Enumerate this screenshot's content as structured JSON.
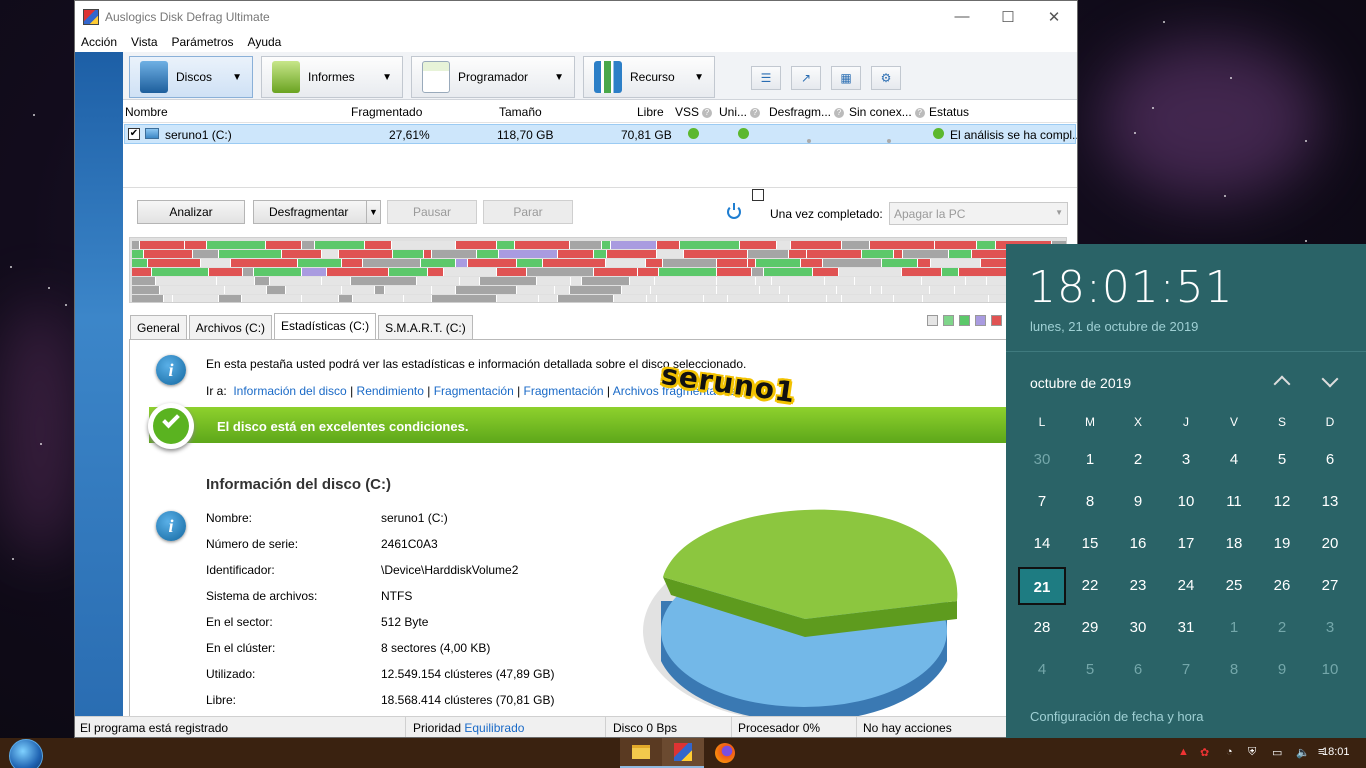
{
  "window": {
    "title": "Auslogics Disk Defrag Ultimate",
    "minimize": "—",
    "maximize": "☐",
    "close": "✕"
  },
  "menu": [
    "Acción",
    "Vista",
    "Parámetros",
    "Ayuda"
  ],
  "toolbar": {
    "tabs": [
      {
        "label": "Discos"
      },
      {
        "label": "Informes"
      },
      {
        "label": "Programador"
      },
      {
        "label": "Recurso"
      }
    ]
  },
  "disk_table": {
    "headers": [
      "Nombre",
      "Fragmentado",
      "Tamaño",
      "Libre",
      "VSS",
      "Uni...",
      "Desfragm...",
      "Sin conex...",
      "Estatus"
    ],
    "rows": [
      {
        "checked": true,
        "name": "seruno1 (C:)",
        "fragmented": "27,61%",
        "size": "118,70 GB",
        "free": "70,81 GB",
        "status": "El análisis se ha compl..."
      }
    ]
  },
  "actions": {
    "analyze": "Analizar",
    "defrag": "Desfragmentar",
    "pause": "Pausar",
    "stop": "Parar",
    "when_done_label": "Una vez completado:",
    "when_done_value": "Apagar la PC"
  },
  "cluster_colors": {
    "fragmented": "#e05353",
    "defragmented": "#5cc86a",
    "system": "#a5a5a5",
    "mft": "#a99be0",
    "free": "#e5e5e5"
  },
  "tabs": [
    "General",
    "Archivos (C:)",
    "Estadísticas (C:)",
    "S.M.A.R.T. (C:)"
  ],
  "active_tab": "Estadísticas (C:)",
  "stats": {
    "intro": "En esta pestaña usted podrá ver las estadísticas e información detallada sobre el disco seleccionado.",
    "goto_label": "Ir a:",
    "links": [
      "Información del disco",
      "Rendimiento",
      "Fragmentación",
      "Fragmentación",
      "Archivos fragmentados"
    ],
    "health": "El disco está en excelentes condiciones.",
    "section_title": "Información del disco (C:)",
    "info": [
      {
        "k": "Nombre:",
        "v": "seruno1 (C:)"
      },
      {
        "k": "Número de serie:",
        "v": "2461C0A3"
      },
      {
        "k": "Identificador:",
        "v": "\\Device\\HarddiskVolume2"
      },
      {
        "k": "Sistema de archivos:",
        "v": "NTFS"
      },
      {
        "k": "En el sector:",
        "v": "512 Byte"
      },
      {
        "k": "En el clúster:",
        "v": "8 sectores (4,00 KB)"
      },
      {
        "k": "Utilizado:",
        "v": "12.549.154 clústeres (47,89 GB)"
      },
      {
        "k": "Libre:",
        "v": "18.568.414 clústeres (70,81 GB)"
      }
    ],
    "pie": {
      "used_color": "#73b8e8",
      "free_color": "#8cc63f"
    }
  },
  "status": {
    "registered": "El programa está registrado",
    "priority_label": "Prioridad",
    "priority_value": "Equilibrado",
    "disk": "Disco 0 Bps",
    "cpu": "Procesador 0%",
    "actions": "No hay acciones"
  },
  "watermark": "seruno1",
  "calendar": {
    "time": "18:01:51",
    "date": "lunes, 21 de octubre de 2019",
    "month": "octubre de 2019",
    "dow": [
      "L",
      "M",
      "X",
      "J",
      "V",
      "S",
      "D"
    ],
    "days": [
      [
        "30",
        1
      ],
      [
        "1",
        0
      ],
      [
        "2",
        0
      ],
      [
        "3",
        0
      ],
      [
        "4",
        0
      ],
      [
        "5",
        0
      ],
      [
        "6",
        0
      ],
      [
        "7",
        0
      ],
      [
        "8",
        0
      ],
      [
        "9",
        0
      ],
      [
        "10",
        0
      ],
      [
        "11",
        0
      ],
      [
        "12",
        0
      ],
      [
        "13",
        0
      ],
      [
        "14",
        0
      ],
      [
        "15",
        0
      ],
      [
        "16",
        0
      ],
      [
        "17",
        0
      ],
      [
        "18",
        0
      ],
      [
        "19",
        0
      ],
      [
        "20",
        0
      ],
      [
        "21",
        2
      ],
      [
        "22",
        0
      ],
      [
        "23",
        0
      ],
      [
        "24",
        0
      ],
      [
        "25",
        0
      ],
      [
        "26",
        0
      ],
      [
        "27",
        0
      ],
      [
        "28",
        0
      ],
      [
        "29",
        0
      ],
      [
        "30",
        0
      ],
      [
        "31",
        0
      ],
      [
        "1",
        1
      ],
      [
        "2",
        1
      ],
      [
        "3",
        1
      ],
      [
        "4",
        1
      ],
      [
        "5",
        1
      ],
      [
        "6",
        1
      ],
      [
        "7",
        1
      ],
      [
        "8",
        1
      ],
      [
        "9",
        1
      ],
      [
        "10",
        1
      ]
    ],
    "settings": "Configuración de fecha y hora"
  },
  "taskbar": {
    "clock": "18:01"
  }
}
